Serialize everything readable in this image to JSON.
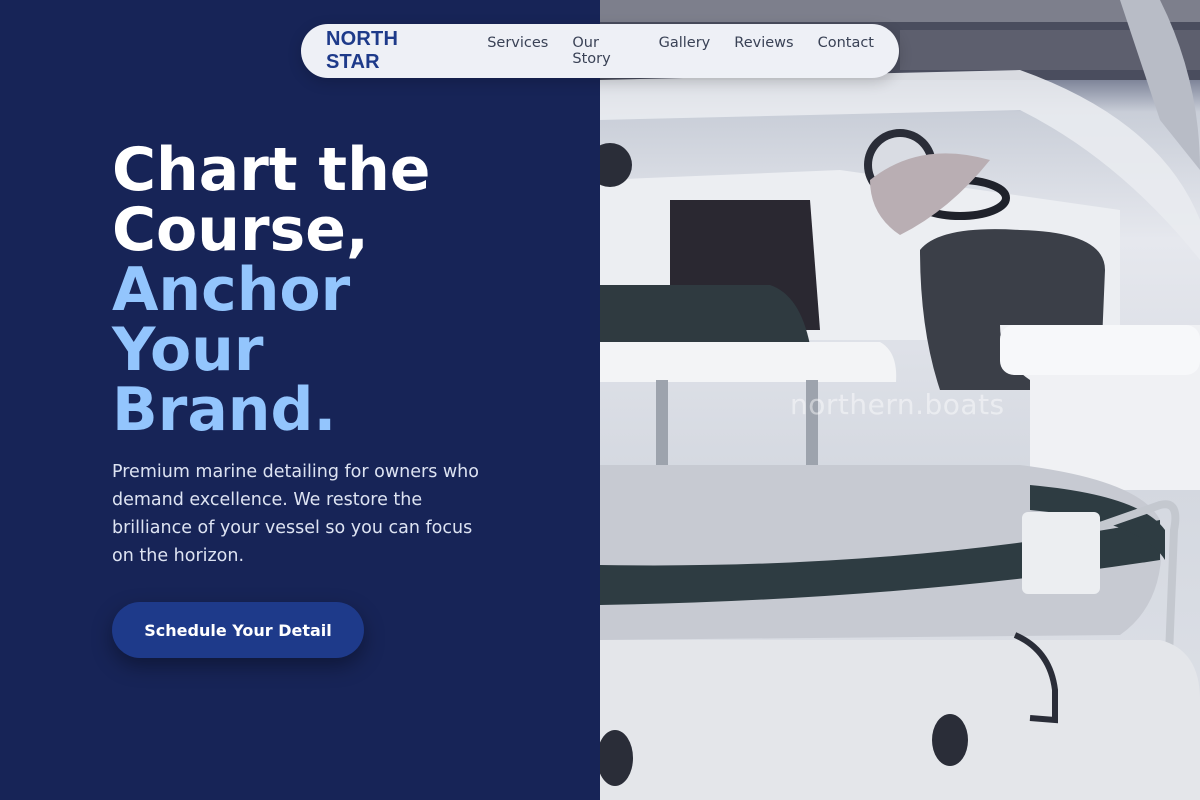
{
  "nav": {
    "brand": "NORTH STAR",
    "links": [
      "Services",
      "Our Story",
      "Gallery",
      "Reviews",
      "Contact"
    ]
  },
  "hero": {
    "headline_white": [
      "Chart the",
      "Course,"
    ],
    "headline_accent": [
      "Anchor",
      "Your",
      "Brand."
    ],
    "subtext": "Premium marine detailing for owners who demand excellence. We restore the brilliance of your vessel so you can focus on the horizon.",
    "cta_label": "Schedule Your Detail"
  },
  "image": {
    "watermark": "northern.boats"
  },
  "colors": {
    "navy_background": "#172457",
    "brand_blue": "#1e3a8a",
    "accent_light_blue": "#93c5fd",
    "nav_background": "#eef0f6"
  }
}
